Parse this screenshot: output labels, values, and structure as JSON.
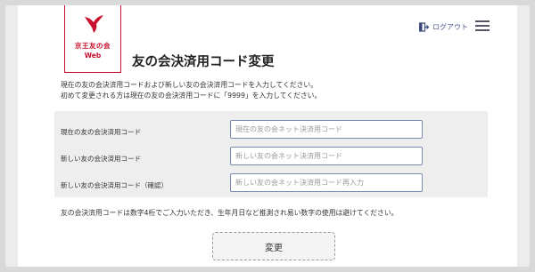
{
  "header": {
    "logo_name": "京王友の会",
    "logo_web": "Web",
    "logout_label": "ログアウト"
  },
  "page_title": "友の会決済用コード変更",
  "description": [
    "現在の友の会決済用コードおよび新しい友の会決済用コードを入力してください。",
    "初めて変更される方は現在の友の会決済用コードに「9999」を入力してください。"
  ],
  "form": {
    "rows": [
      {
        "label": "現在の友の会決済用コード",
        "placeholder": "現在の友の会ネット決済用コード"
      },
      {
        "label": "新しい友の会決済用コード",
        "placeholder": "新しい友の会ネット決済用コード"
      },
      {
        "label": "新しい友の会決済用コード（確認）",
        "placeholder": "新しい友の会ネット決済用コード再入力"
      }
    ]
  },
  "note": "友の会決済用コードは数字4桁でご入力いただき、生年月日など推測され易い数字の使用は避けてください。",
  "submit_label": "変更",
  "colors": {
    "brand_red": "#c8102e",
    "link_blue": "#4a5a8a"
  },
  "icons": {
    "logo": "bird-logo-icon",
    "logout": "logout-icon",
    "menu": "hamburger-menu-icon"
  }
}
